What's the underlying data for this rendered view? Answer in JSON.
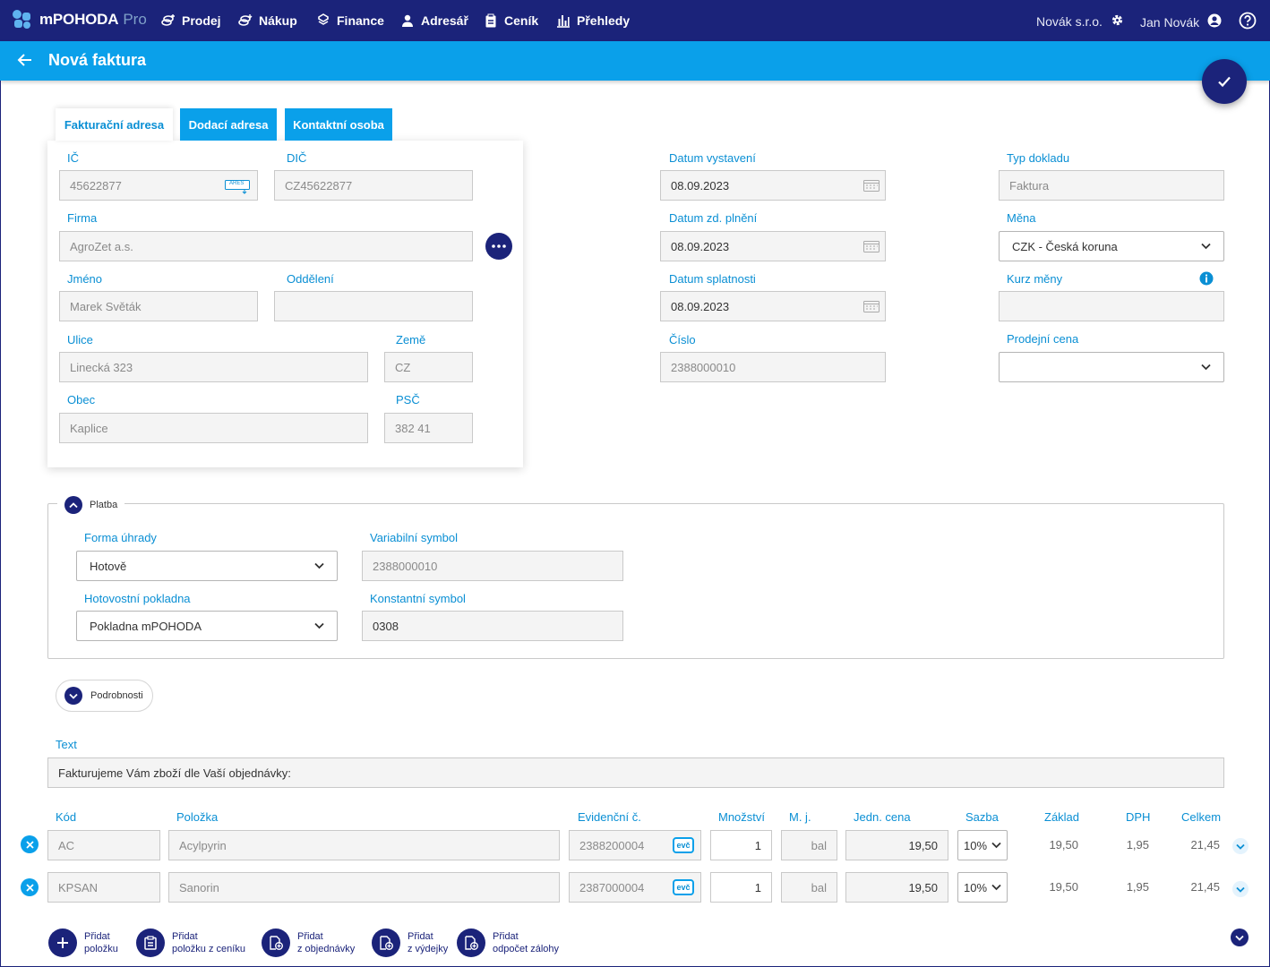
{
  "app": {
    "brand": "mPOHODA",
    "edition": "Pro"
  },
  "nav": {
    "prodej": "Prodej",
    "nakup": "Nákup",
    "finance": "Finance",
    "adresar": "Adresář",
    "cenik": "Ceník",
    "prehledy": "Přehledy"
  },
  "account": {
    "company": "Novák s.r.o.",
    "user": "Jan Novák"
  },
  "page": {
    "title": "Nová faktura"
  },
  "tabs": {
    "fakturacni": "Fakturační adresa",
    "dodaci": "Dodací adresa",
    "kontaktni": "Kontaktní osoba"
  },
  "address": {
    "ic_label": "IČ",
    "ic": "45622877",
    "ares": "ARES",
    "dic_label": "DIČ",
    "dic": "CZ45622877",
    "firma_label": "Firma",
    "firma": "AgroZet a.s.",
    "jmeno_label": "Jméno",
    "jmeno": "Marek Světák",
    "oddeleni_label": "Oddělení",
    "oddeleni": "",
    "ulice_label": "Ulice",
    "ulice": "Linecká 323",
    "zeme_label": "Země",
    "zeme": "CZ",
    "obec_label": "Obec",
    "obec": "Kaplice",
    "psc_label": "PSČ",
    "psc": "382 41"
  },
  "dates": {
    "vystaveni_label": "Datum vystavení",
    "vystaveni": "08.09.2023",
    "plneni_label": "Datum zd. plnění",
    "plneni": "08.09.2023",
    "splatnosti_label": "Datum splatnosti",
    "splatnosti": "08.09.2023",
    "cislo_label": "Číslo",
    "cislo": "2388000010"
  },
  "doc": {
    "typ_label": "Typ dokladu",
    "typ": "Faktura",
    "mena_label": "Měna",
    "mena": "CZK - Česká koruna",
    "kurz_label": "Kurz měny",
    "kurz": "",
    "prodejni_label": "Prodejní cena",
    "prodejni": ""
  },
  "platba": {
    "legend": "Platba",
    "forma_label": "Forma úhrady",
    "forma": "Hotově",
    "vs_label": "Variabilní symbol",
    "vs": "2388000010",
    "pokladna_label": "Hotovostní pokladna",
    "pokladna": "Pokladna mPOHODA",
    "ks_label": "Konstantní symbol",
    "ks": "0308"
  },
  "podrobnosti": "Podrobnosti",
  "text": {
    "label": "Text",
    "value": "Fakturujeme Vám zboží dle Vaší objednávky:"
  },
  "table": {
    "headers": {
      "kod": "Kód",
      "polozka": "Položka",
      "evidencni": "Evidenční č.",
      "mnozstvi": "Množství",
      "mj": "M. j.",
      "jedn_cena": "Jedn. cena",
      "sazba": "Sazba",
      "zaklad": "Základ",
      "dph": "DPH",
      "celkem": "Celkem"
    },
    "evc_badge": "evč",
    "rows": [
      {
        "kod": "AC",
        "polozka": "Acylpyrin",
        "evidencni": "2388200004",
        "mnozstvi": "1",
        "mj": "bal",
        "jedn_cena": "19,50",
        "sazba": "10%",
        "zaklad": "19,50",
        "dph": "1,95",
        "celkem": "21,45"
      },
      {
        "kod": "KPSAN",
        "polozka": "Sanorin",
        "evidencni": "2387000004",
        "mnozstvi": "1",
        "mj": "bal",
        "jedn_cena": "19,50",
        "sazba": "10%",
        "zaklad": "19,50",
        "dph": "1,95",
        "celkem": "21,45"
      }
    ]
  },
  "actions": {
    "pridat_polozku": [
      "Přidat",
      "položku"
    ],
    "pridat_cenik": [
      "Přidat",
      "položku z ceníku"
    ],
    "pridat_objednavky": [
      "Přidat",
      "z objednávky"
    ],
    "pridat_vydejky": [
      "Přidat",
      "z výdejky"
    ],
    "pridat_zalohy": [
      "Přidat",
      "odpočet zálohy"
    ]
  },
  "colors": {
    "navy": "#1b237a",
    "blue": "#0aa0ea",
    "label": "#0a8fd4"
  }
}
